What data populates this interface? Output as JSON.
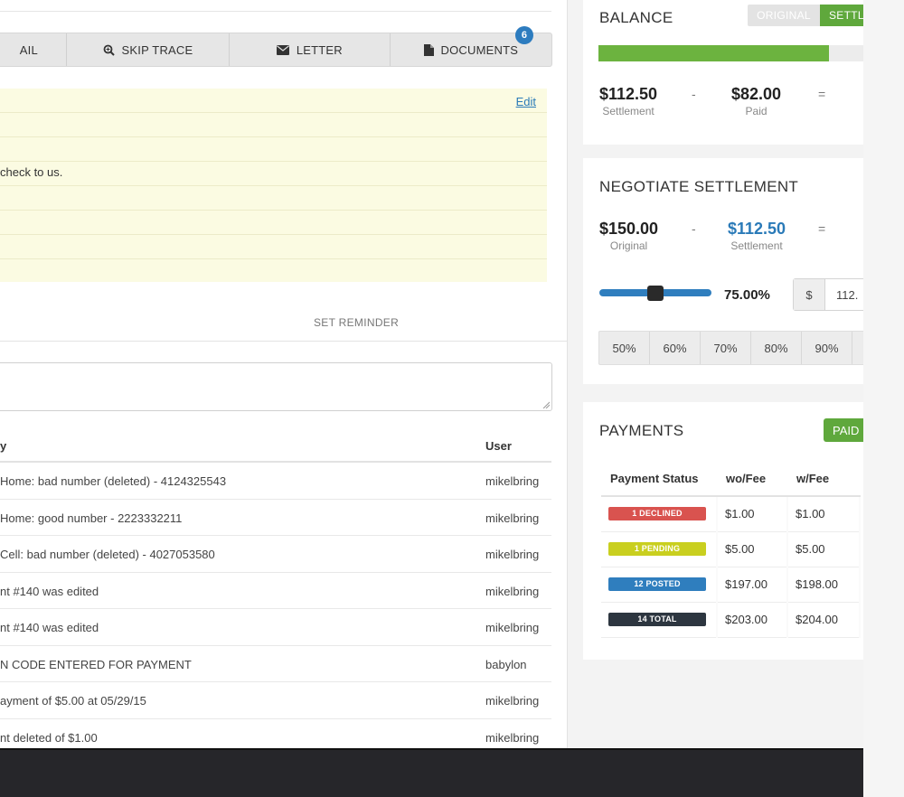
{
  "tabs": [
    {
      "label": "AIL",
      "icon": "none"
    },
    {
      "label": "SKIP TRACE",
      "icon": "magnifier-icon"
    },
    {
      "label": "LETTER",
      "icon": "envelope-icon"
    },
    {
      "label": "DOCUMENTS",
      "icon": "document-icon",
      "badge": "6"
    }
  ],
  "note": {
    "edit_label": "Edit",
    "text": "check to us."
  },
  "reminder": {
    "label": "SET REMINDER"
  },
  "history": {
    "headers": {
      "activity": "y",
      "user": "User"
    },
    "rows": [
      {
        "activity": "Home: bad number (deleted) - 4124325543",
        "user": "mikelbring"
      },
      {
        "activity": "Home: good number - 2223332211",
        "user": "mikelbring"
      },
      {
        "activity": "Cell: bad number (deleted) - 4027053580",
        "user": "mikelbring"
      },
      {
        "activity": "nt #140 was edited",
        "user": "mikelbring"
      },
      {
        "activity": "nt #140 was edited",
        "user": "mikelbring"
      },
      {
        "activity": "N CODE ENTERED FOR PAYMENT",
        "user": "babylon"
      },
      {
        "activity": "ayment of $5.00 at 05/29/15",
        "user": "mikelbring"
      },
      {
        "activity": "nt deleted of $1.00",
        "user": "mikelbring"
      }
    ]
  },
  "balance": {
    "title": "BALANCE",
    "toggle_original": "ORIGINAL",
    "toggle_settlement": "SETTL",
    "progress_fraction": 0.85,
    "bar_color": "#6cb33f",
    "settlement": {
      "value": "$112.50",
      "label": "Settlement"
    },
    "op1": "-",
    "paid": {
      "value": "$82.00",
      "label": "Paid"
    },
    "op2": "="
  },
  "negotiate": {
    "title": "NEGOTIATE SETTLEMENT",
    "original": {
      "value": "$150.00",
      "label": "Original"
    },
    "op1": "-",
    "settlement": {
      "value": "$112.50",
      "label": "Settlement"
    },
    "op2": "=",
    "slider_percent": "75.00%",
    "slider_fraction": 0.5,
    "input_prefix": "$",
    "input_value": "112.",
    "percent_buttons": [
      "50%",
      "60%",
      "70%",
      "80%",
      "90%"
    ]
  },
  "payments": {
    "title": "PAYMENTS",
    "paid_button": "PAID",
    "headers": {
      "status": "Payment Status",
      "wo_fee": "wo/Fee",
      "w_fee": "w/Fee"
    },
    "rows": [
      {
        "status": "1 DECLINED",
        "color": "#d9534f",
        "wo_fee": "$1.00",
        "w_fee": "$1.00"
      },
      {
        "status": "1 PENDING",
        "color": "#c9cf1f",
        "wo_fee": "$5.00",
        "w_fee": "$5.00"
      },
      {
        "status": "12 POSTED",
        "color": "#2f7ebe",
        "wo_fee": "$197.00",
        "w_fee": "$198.00"
      },
      {
        "status": "14 TOTAL",
        "color": "#2d3640",
        "wo_fee": "$203.00",
        "w_fee": "$204.00"
      }
    ]
  }
}
